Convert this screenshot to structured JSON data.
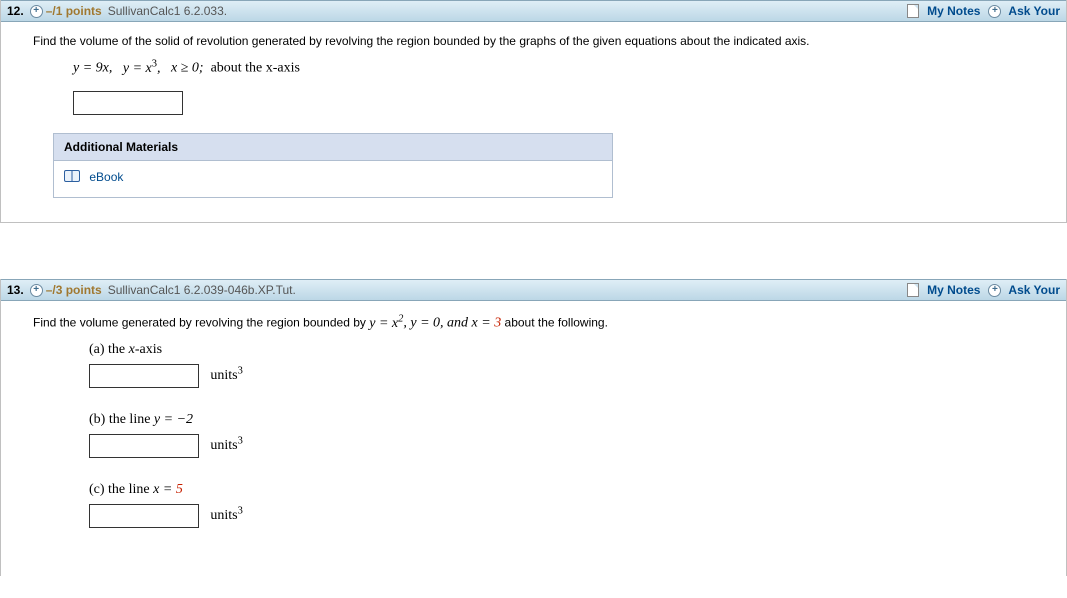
{
  "q12": {
    "num": "12.",
    "points": "–/1 points",
    "source": "SullivanCalc1 6.2.033.",
    "mynotes": "My Notes",
    "ask": "Ask Your",
    "prompt": "Find the volume of the solid of revolution generated by revolving the region bounded by the graphs of the given equations about the indicated axis.",
    "eq_y9x": "y = 9x,",
    "eq_yx3_pre": "y = x",
    "eq_yx3_sup": "3",
    "eq_yx3_post": ",",
    "eq_xge0": "x ≥ 0;",
    "about": "about the x-axis",
    "materials_h": "Additional Materials",
    "ebook": "eBook"
  },
  "q13": {
    "num": "13.",
    "points": "–/3 points",
    "source": "SullivanCalc1 6.2.039-046b.XP.Tut.",
    "mynotes": "My Notes",
    "ask": "Ask Your",
    "prompt_pre": "Find the volume generated by revolving the region bounded by  ",
    "prompt_yx2_pre": "y = x",
    "prompt_yx2_sup": "2",
    "prompt_mid": ", y = 0, and x = ",
    "prompt_red": "3",
    "prompt_post": "  about the following.",
    "a": {
      "label_pre": "(a) the ",
      "label_math": "x",
      "label_post": "-axis",
      "units": "units",
      "sup": "3"
    },
    "b": {
      "label_pre": "(b) the line  ",
      "label_math": "y = −2",
      "units": "units",
      "sup": "3"
    },
    "c": {
      "label_pre": "(c) the line  ",
      "label_math": "x = ",
      "label_red": "5",
      "units": "units",
      "sup": "3"
    }
  }
}
